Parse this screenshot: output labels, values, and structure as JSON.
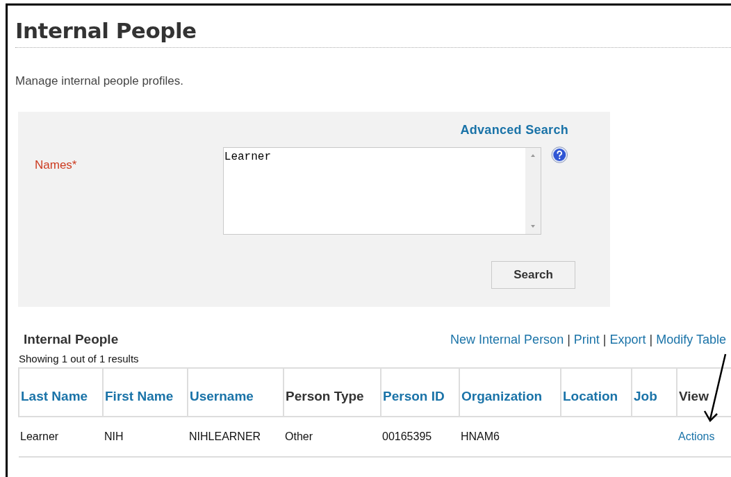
{
  "page_title": "Internal People",
  "description": "Manage internal people profiles.",
  "search_panel": {
    "advanced_link": "Advanced Search",
    "field_label": "Names*",
    "field_value": "Learner",
    "button": "Search"
  },
  "results": {
    "title": "Internal People",
    "actions": [
      "New Internal Person",
      "Print",
      "Export",
      "Modify Table"
    ],
    "action_separator": "|",
    "summary": "Showing 1 out of 1 results",
    "columns": [
      {
        "label": "Last Name",
        "sortable": true
      },
      {
        "label": "First Name",
        "sortable": true
      },
      {
        "label": "Username",
        "sortable": true
      },
      {
        "label": "Person Type",
        "sortable": false
      },
      {
        "label": "Person ID",
        "sortable": true
      },
      {
        "label": "Organization",
        "sortable": true
      },
      {
        "label": "Location",
        "sortable": true
      },
      {
        "label": "Job",
        "sortable": true
      },
      {
        "label": "View",
        "sortable": false
      }
    ],
    "rows": [
      {
        "cells": [
          {
            "text": "Learner",
            "kind": "text"
          },
          {
            "text": "NIH",
            "kind": "text"
          },
          {
            "text": "NIHLEARNER",
            "kind": "text"
          },
          {
            "text": "Other",
            "kind": "text"
          },
          {
            "text": "00165395",
            "kind": "text"
          },
          {
            "text": "HNAM6",
            "kind": "text"
          },
          {
            "text": "",
            "kind": "text"
          },
          {
            "text": "",
            "kind": "text"
          },
          {
            "text": "Actions",
            "kind": "link"
          }
        ]
      }
    ]
  },
  "annotation": {
    "kind": "arrow"
  }
}
